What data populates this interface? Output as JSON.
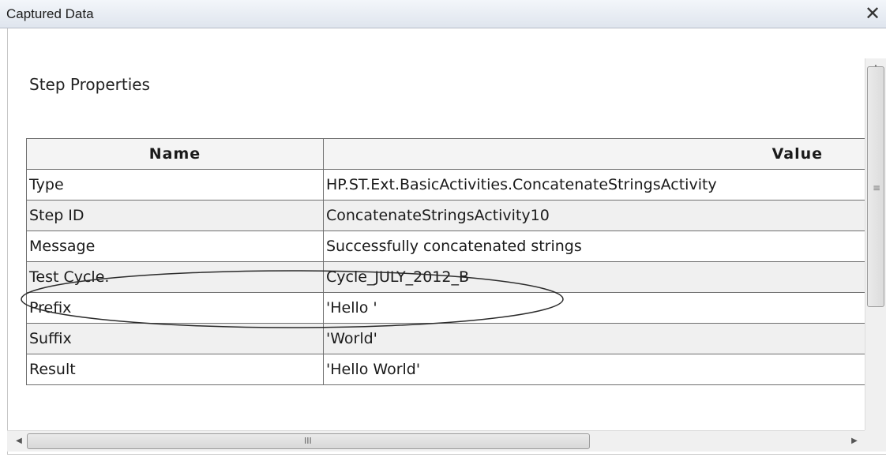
{
  "window": {
    "title": "Captured Data",
    "close_glyph": "✕"
  },
  "section": {
    "heading": "Step Properties"
  },
  "table": {
    "headers": [
      "Name",
      "Value"
    ],
    "rows": [
      {
        "name": "Type",
        "value": "HP.ST.Ext.BasicActivities.ConcatenateStringsActivity"
      },
      {
        "name": "Step ID",
        "value": "ConcatenateStringsActivity10"
      },
      {
        "name": "Message",
        "value": "Successfully concatenated strings"
      },
      {
        "name": "Test Cycle.",
        "value": "Cycle_JULY_2012_B"
      },
      {
        "name": "Prefix",
        "value": "'Hello '"
      },
      {
        "name": "Suffix",
        "value": "'World'"
      },
      {
        "name": "Result",
        "value": "'Hello World'"
      }
    ]
  },
  "scrollbars": {
    "up_glyph": "▲",
    "down_glyph": "▼",
    "left_glyph": "◀",
    "right_glyph": "▶",
    "v_grip": "≡",
    "h_grip": "III"
  },
  "colors": {
    "titlebar": "#dfe5ee",
    "border": "#6f6f6f",
    "header_bg": "#f4f4f4"
  }
}
